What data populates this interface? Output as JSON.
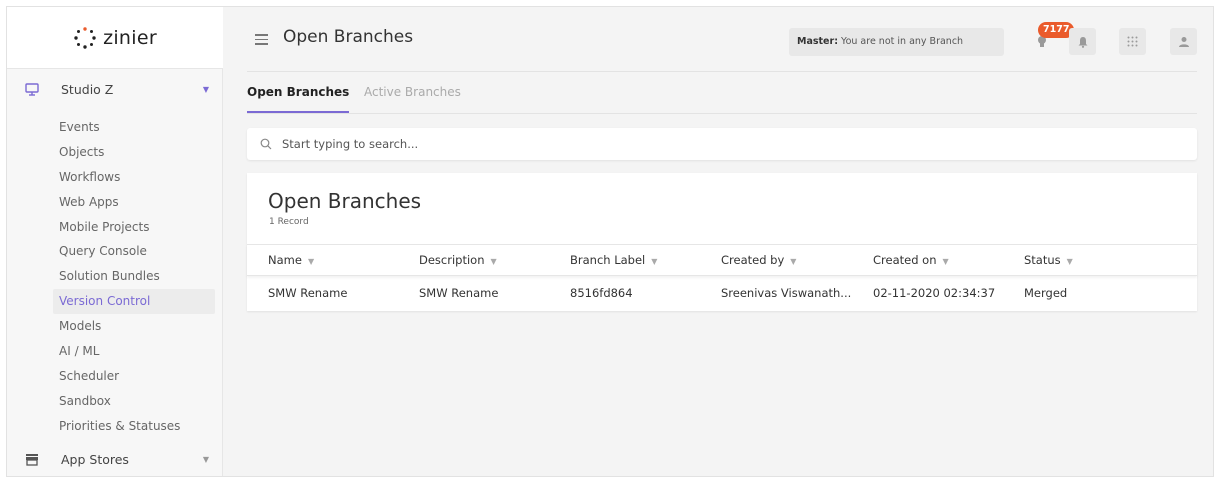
{
  "brand": {
    "name": "zinier"
  },
  "sidebar": {
    "section": {
      "label": "Studio Z"
    },
    "items": [
      {
        "label": "Events"
      },
      {
        "label": "Objects"
      },
      {
        "label": "Workflows"
      },
      {
        "label": "Web Apps"
      },
      {
        "label": "Mobile Projects"
      },
      {
        "label": "Query Console"
      },
      {
        "label": "Solution Bundles"
      },
      {
        "label": "Version Control",
        "active": true
      },
      {
        "label": "Models"
      },
      {
        "label": "AI / ML"
      },
      {
        "label": "Scheduler"
      },
      {
        "label": "Sandbox"
      },
      {
        "label": "Priorities & Statuses"
      }
    ],
    "bottom_section": {
      "label": "App Stores"
    }
  },
  "header": {
    "title": "Open Branches",
    "master_label": "Master:",
    "master_text": "You are not in any Branch",
    "notification_count": "7177"
  },
  "tabs": [
    {
      "label": "Open Branches",
      "active": true
    },
    {
      "label": "Active Branches",
      "active": false
    }
  ],
  "search": {
    "placeholder": "Start typing to search..."
  },
  "table": {
    "title": "Open Branches",
    "record_count": "1 Record",
    "columns": [
      "Name",
      "Description",
      "Branch Label",
      "Created by",
      "Created on",
      "Status"
    ],
    "rows": [
      [
        "SMW Rename",
        "SMW Rename",
        "8516fd864",
        "Sreenivas Viswanath...",
        "02-11-2020 02:34:37",
        "Merged"
      ]
    ]
  },
  "colors": {
    "accent": "#7b6ad4",
    "badge": "#ea5b2c",
    "background": "#f4f4f4"
  },
  "icons": {
    "logo": "zinier-dots-logo",
    "studio": "monitor-icon",
    "app_stores": "store-icon",
    "menu": "hamburger-icon",
    "search": "search-icon",
    "bulb": "lightbulb-icon",
    "bell": "bell-icon",
    "apps": "grid-icon",
    "user": "user-icon"
  }
}
